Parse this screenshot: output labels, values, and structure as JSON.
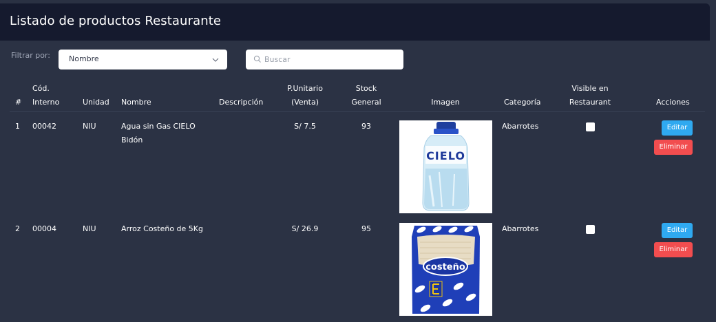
{
  "header": {
    "title": "Listado de productos Restaurante"
  },
  "filter": {
    "label": "Filtrar por:",
    "select_value": "Nombre",
    "search_placeholder": "Buscar"
  },
  "columns": {
    "index": "#",
    "code_line1": "Cód.",
    "code_line2": "Interno",
    "unit": "Unidad",
    "name": "Nombre",
    "description": "Descripción",
    "price_line1": "P.Unitario",
    "price_line2": "(Venta)",
    "stock_line1": "Stock",
    "stock_line2": "General",
    "image": "Imagen",
    "category": "Categoría",
    "visible_line1": "Visible en",
    "visible_line2": "Restaurant",
    "actions": "Acciones"
  },
  "rows": [
    {
      "index": "1",
      "code": "00042",
      "unit": "NIU",
      "name_line1": "Agua sin Gas CIELO",
      "name_line2": "Bidón",
      "description": "",
      "price": "S/ 7.5",
      "stock": "93",
      "image_brand": "CIELO",
      "category": "Abarrotes",
      "visible": false,
      "edit_label": "Editar",
      "delete_label": "Eliminar"
    },
    {
      "index": "2",
      "code": "00004",
      "unit": "NIU",
      "name_line1": "Arroz Costeño de 5Kg",
      "name_line2": "",
      "description": "",
      "price": "S/ 26.9",
      "stock": "95",
      "image_brand": "costeño",
      "category": "Abarrotes",
      "visible": false,
      "edit_label": "Editar",
      "delete_label": "Eliminar"
    }
  ],
  "colors": {
    "background": "#2b3244",
    "header": "#151a2e",
    "edit_button": "#2fa9f0",
    "delete_button": "#f24d4f"
  }
}
